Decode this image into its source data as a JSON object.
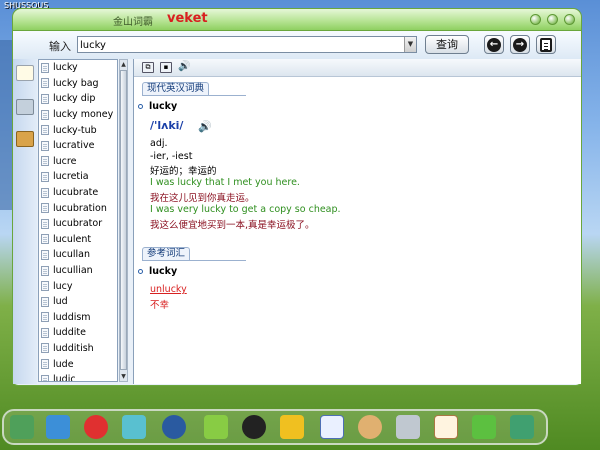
{
  "desktop": {
    "label": "SHUSSOUS"
  },
  "window": {
    "app_name": "金山词霸",
    "brand": "veket"
  },
  "toolbar": {
    "input_label": "输入",
    "search_value": "lucky",
    "query_button": "查询"
  },
  "word_list": [
    "lucky",
    "lucky bag",
    "lucky dip",
    "lucky money",
    "lucky-tub",
    "lucrative",
    "lucre",
    "lucretia",
    "lucubrate",
    "lucubration",
    "lucubrator",
    "luculent",
    "lucullan",
    "lucullian",
    "lucy",
    "lud",
    "luddism",
    "luddite",
    "ludditish",
    "lude",
    "ludic"
  ],
  "definition": {
    "section_title": "现代英汉词典",
    "headword": "lucky",
    "phonetic": "/'lʌki/",
    "pos": "adj.",
    "forms": "-ier, -iest",
    "meaning": "好运的；幸运的",
    "ex1_en": "I was lucky that I met you here.",
    "ex1_zh": "我在这儿见到你真走运。",
    "ex2_en": "I was very lucky to get a copy so cheap.",
    "ex2_zh": "我这么便宜地买到一本,真是幸运极了。"
  },
  "reference": {
    "section_title": "参考词汇",
    "headword": "lucky",
    "link": "unlucky",
    "meaning": "不幸"
  }
}
